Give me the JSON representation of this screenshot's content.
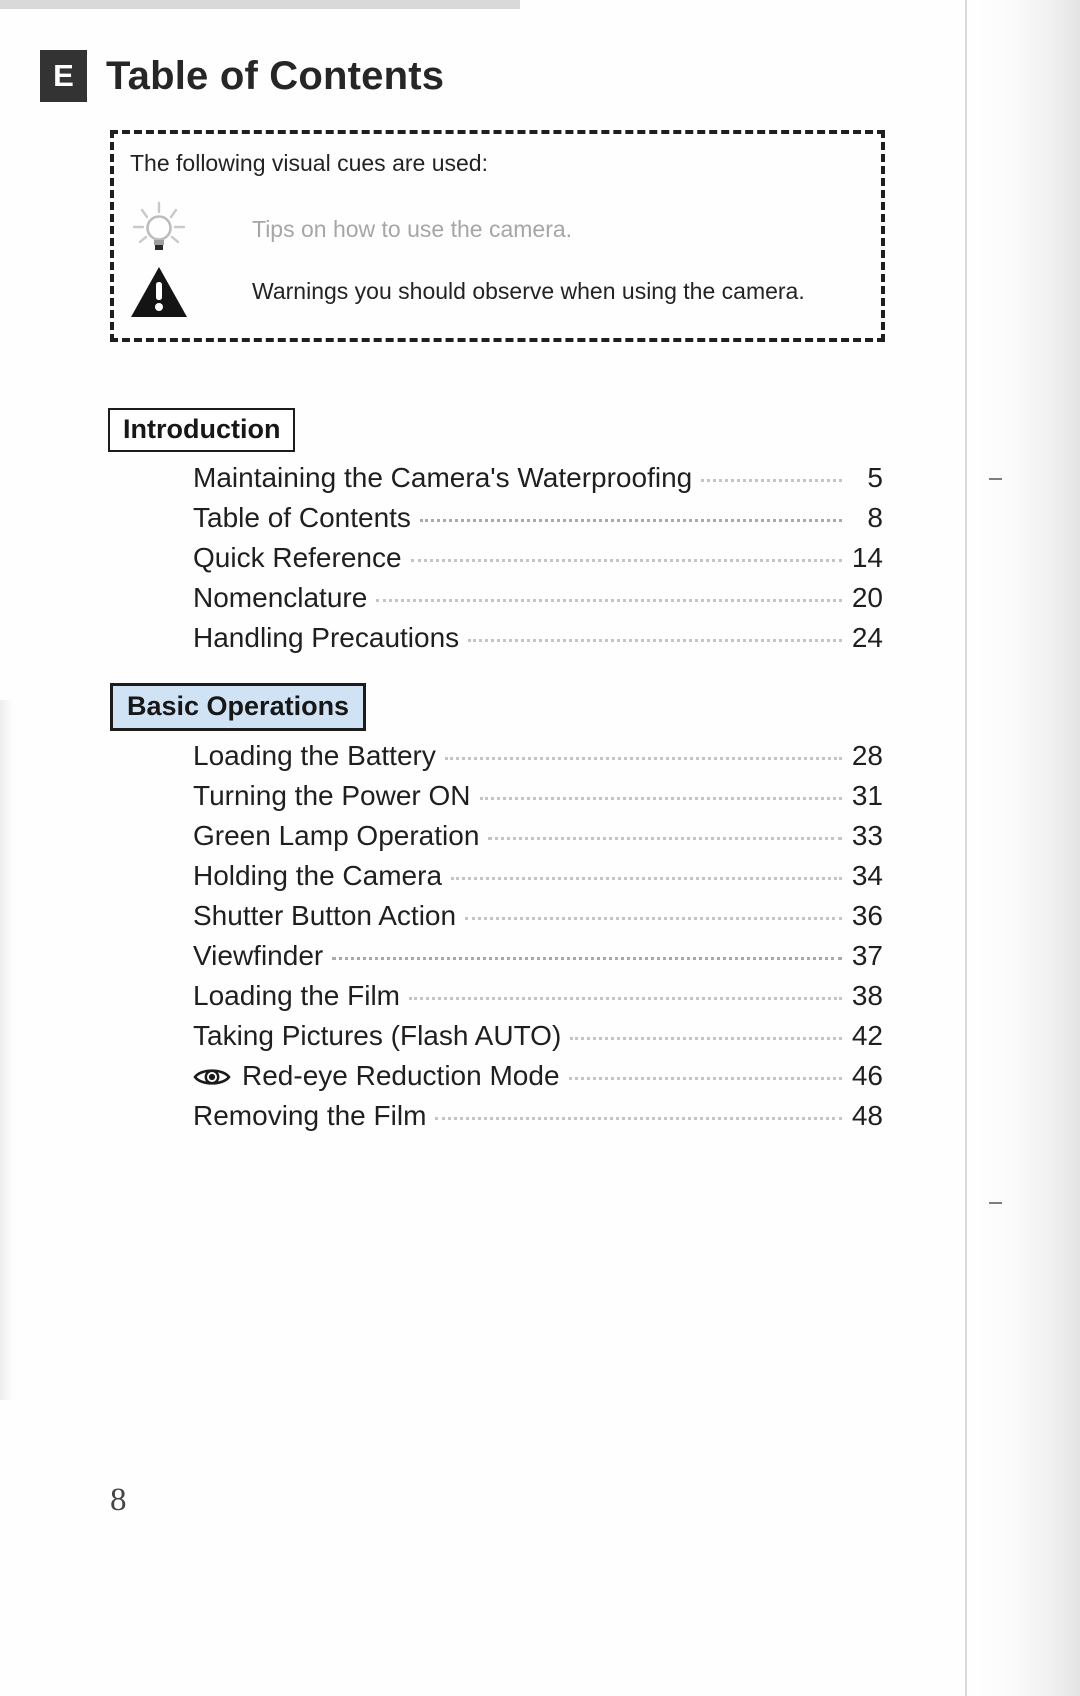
{
  "document": {
    "language_badge": "E",
    "title": "Table of Contents",
    "folio": "8"
  },
  "cue_box": {
    "intro_text": "The following visual cues are used:",
    "cues": [
      {
        "icon": "lightbulb-icon",
        "text": "Tips on how to use the camera."
      },
      {
        "icon": "warning-triangle-icon",
        "text": "Warnings you should observe when using the camera."
      }
    ]
  },
  "sections": [
    {
      "heading": "Introduction",
      "entries": [
        {
          "label": "Maintaining the Camera's Waterproofing",
          "page": "5"
        },
        {
          "label": "Table of Contents",
          "page": "8"
        },
        {
          "label": "Quick Reference",
          "page": "14"
        },
        {
          "label": "Nomenclature",
          "page": "20"
        },
        {
          "label": "Handling Precautions",
          "page": "24"
        }
      ]
    },
    {
      "heading": "Basic Operations",
      "entries": [
        {
          "label": "Loading the Battery",
          "page": "28"
        },
        {
          "label": "Turning the Power ON",
          "page": "31"
        },
        {
          "label": "Green Lamp Operation",
          "page": "33"
        },
        {
          "label": "Holding the Camera",
          "page": "34"
        },
        {
          "label": "Shutter Button Action",
          "page": "36"
        },
        {
          "label": "Viewfinder",
          "page": "37"
        },
        {
          "label": "Loading the Film",
          "page": "38"
        },
        {
          "label": "Taking Pictures (Flash AUTO)",
          "page": "42"
        },
        {
          "label": "Red-eye Reduction Mode",
          "page": "46",
          "icon": "red-eye-icon"
        },
        {
          "label": "Removing the Film",
          "page": "48"
        }
      ]
    }
  ],
  "colors": {
    "badge_background": "#333333",
    "basic_operations_fill": "#cfe3f5",
    "text": "#1f1f1f",
    "leader_dots": "#c4c4c4"
  }
}
